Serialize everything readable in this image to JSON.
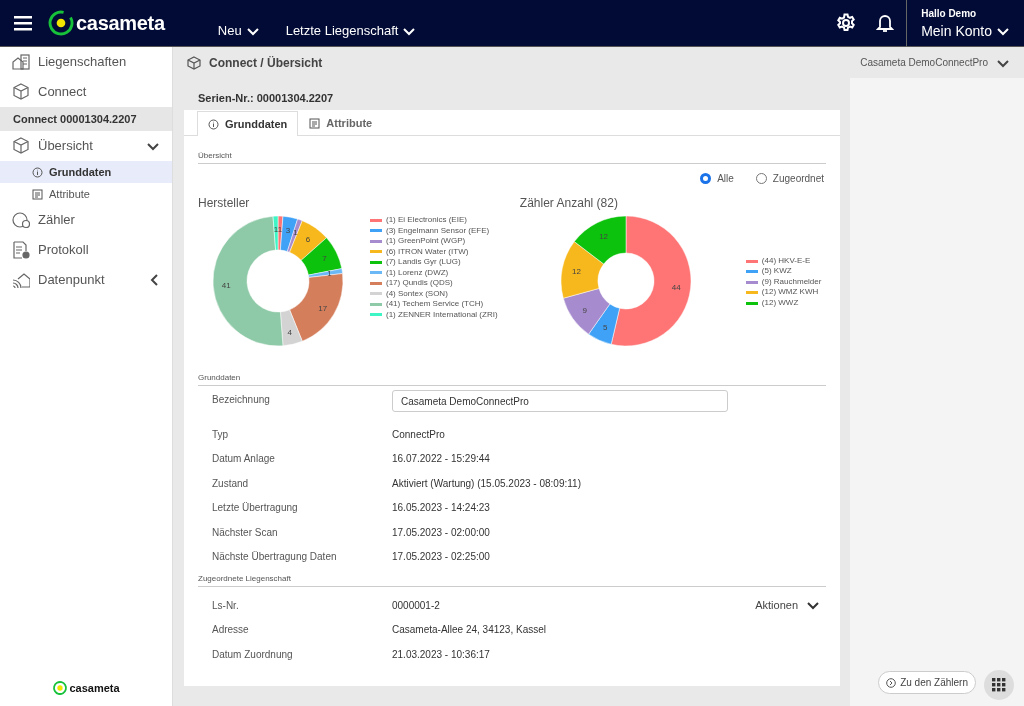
{
  "header": {
    "brand": "casameta",
    "menus": [
      {
        "label": "Neu"
      },
      {
        "label": "Letzte Liegenschaft"
      }
    ],
    "greeting": "Hallo Demo",
    "account": "Mein Konto"
  },
  "sidebar": {
    "items": [
      {
        "label": "Liegenschaften",
        "kind": "nav"
      },
      {
        "label": "Connect",
        "kind": "nav"
      },
      {
        "label": "Connect 00001304.2207",
        "kind": "heading"
      },
      {
        "label": "Übersicht",
        "kind": "nav",
        "expanded": true,
        "children": [
          {
            "label": "Grunddaten",
            "selected": true
          },
          {
            "label": "Attribute",
            "selected": false
          }
        ]
      },
      {
        "label": "Zähler",
        "kind": "nav"
      },
      {
        "label": "Protokoll",
        "kind": "nav"
      },
      {
        "label": "Datenpunkt",
        "kind": "nav",
        "expanded": false
      }
    ],
    "footer_brand": "casameta"
  },
  "breadcrumb": "Connect / Übersicht",
  "device_selector": "Casameta DemoConnectPro",
  "card": {
    "title": "Serien-Nr.: 00001304.2207",
    "tabs": [
      {
        "label": "Grunddaten",
        "selected": true
      },
      {
        "label": "Attribute",
        "selected": false
      }
    ],
    "overview": {
      "heading": "Übersicht",
      "filters": [
        {
          "label": "Alle",
          "selected": true
        },
        {
          "label": "Zugeordnet",
          "selected": false
        }
      ],
      "charts": [
        {
          "chart_data": {
            "type": "donut",
            "title": "Hersteller",
            "categories": [
              "(1) Ei Electronics (EIE)",
              "(3) Engelmann Sensor (EFE)",
              "(1) GreenPoint (WGP)",
              "(6) ITRON Water (ITW)",
              "(7) Landis Gyr (LUG)",
              "(1) Lorenz (DWZ)",
              "(17) Qundis (QDS)",
              "(4) Sontex (SON)",
              "(41) Techem Service (TCH)",
              "(1) ZENNER International (ZRI)"
            ],
            "values": [
              1,
              3,
              1,
              6,
              7,
              1,
              17,
              4,
              41,
              1
            ],
            "colors": [
              "#ff7575",
              "#3fa2f7",
              "#a68bce",
              "#f6b81c",
              "#0cc20c",
              "#6bb8f7",
              "#d47e5c",
              "#d3d3d3",
              "#8fcaa8",
              "#3ef5c5"
            ],
            "data_labels": true,
            "legend": "right"
          }
        },
        {
          "chart_data": {
            "type": "donut",
            "title": "Zähler Anzahl (82)",
            "categories": [
              "(44) HKV-E-E",
              "(5) KWZ",
              "(9) Rauchmelder",
              "(12) WMZ KWH",
              "(12) WWZ"
            ],
            "values": [
              44,
              5,
              9,
              12,
              12
            ],
            "colors": [
              "#ff7575",
              "#3fa2f7",
              "#a68bce",
              "#f6b81c",
              "#0cc20c"
            ],
            "data_labels": true,
            "legend": "right"
          }
        }
      ]
    },
    "basics": {
      "heading": "Grunddaten",
      "rows": [
        {
          "label": "Bezeichnung",
          "value": "Casameta DemoConnectPro",
          "kind": "input"
        },
        {
          "label": "Typ",
          "value": "ConnectPro",
          "kind": "text"
        },
        {
          "label": "Datum Anlage",
          "value": "16.07.2022 - 15:29:44",
          "kind": "text"
        },
        {
          "label": "Zustand",
          "value": "Aktiviert (Wartung) (15.05.2023 - 08:09:11)",
          "kind": "text"
        },
        {
          "label": "Letzte Übertragung",
          "value": "16.05.2023 - 14:24:23",
          "kind": "text"
        },
        {
          "label": "Nächster Scan",
          "value": "17.05.2023 - 02:00:00",
          "kind": "text"
        },
        {
          "label": "Nächste Übertragung Daten",
          "value": "17.05.2023 - 02:25:00",
          "kind": "text"
        }
      ]
    },
    "property": {
      "heading": "Zugeordnete Liegenschaft",
      "actions": "Aktionen",
      "rows": [
        {
          "label": "Ls-Nr.",
          "value": "0000001-2",
          "kind": "text"
        },
        {
          "label": "Adresse",
          "value": "Casameta-Allee 24, 34123, Kassel",
          "kind": "text"
        },
        {
          "label": "Datum Zuordnung",
          "value": "21.03.2023 - 10:36:17",
          "kind": "text"
        }
      ]
    }
  },
  "floating_button": "Zu den Zählern"
}
